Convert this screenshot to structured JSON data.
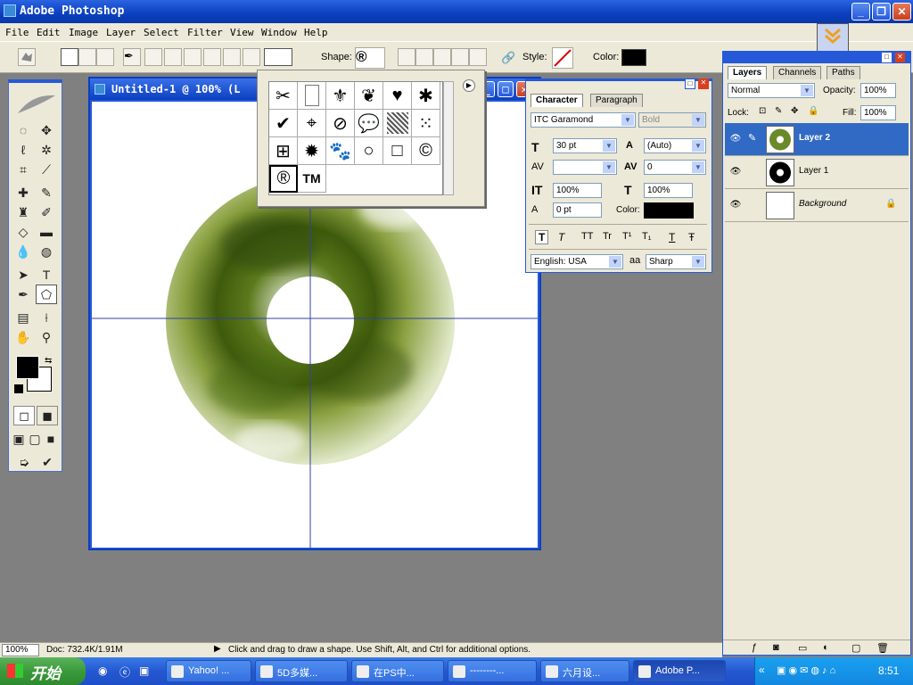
{
  "app": {
    "title": "Adobe Photoshop"
  },
  "menu": [
    "File",
    "Edit",
    "Image",
    "Layer",
    "Select",
    "Filter",
    "View",
    "Window",
    "Help"
  ],
  "options": {
    "shape_label": "Shape:",
    "style_label": "Style:",
    "color_label": "Color:",
    "color_value": "#000000"
  },
  "document": {
    "title": "Untitled-1 @ 100% (L"
  },
  "character": {
    "tab_character": "Character",
    "tab_paragraph": "Paragraph",
    "font_family": "ITC Garamond",
    "font_style": "Bold",
    "size": "30 pt",
    "leading": "(Auto)",
    "kerning": "",
    "tracking": "0",
    "vscale": "100%",
    "hscale": "100%",
    "baseline": "0 pt",
    "color_label": "Color:",
    "language": "English: USA",
    "antialias_icon": "aa",
    "antialias": "Sharp",
    "style_buttons": [
      "T",
      "T",
      "TT",
      "Tr",
      "T¹",
      "T₁",
      "T",
      "Ŧ"
    ]
  },
  "layers": {
    "tab_layers": "Layers",
    "tab_channels": "Channels",
    "tab_paths": "Paths",
    "blend_mode": "Normal",
    "opacity_label": "Opacity:",
    "opacity": "100%",
    "lock_label": "Lock:",
    "fill_label": "Fill:",
    "fill": "100%",
    "items": [
      {
        "name": "Layer 2"
      },
      {
        "name": "Layer 1"
      },
      {
        "name": "Background"
      }
    ]
  },
  "status": {
    "zoom": "100%",
    "doc": "Doc: 732.4K/1.91M",
    "hint": "Click and drag to draw a shape. Use Shift, Alt, and Ctrl for additional options."
  },
  "taskbar": {
    "start": "开始",
    "tasks": [
      "Yahoo! ...",
      "5D多媒...",
      "在PS中...",
      "--------...",
      "六月设...",
      "Adobe P..."
    ],
    "clock": "8:51"
  },
  "shapes": [
    "scissors",
    "blank-page",
    "fleur-de-lis",
    "ornament",
    "heart",
    "splat",
    "checkmark",
    "target",
    "no-sign",
    "speech-bubble",
    "hatch",
    "grid-dots",
    "grid",
    "starburst",
    "paw",
    "circle",
    "square",
    "copyright",
    "registered",
    "trademark"
  ]
}
